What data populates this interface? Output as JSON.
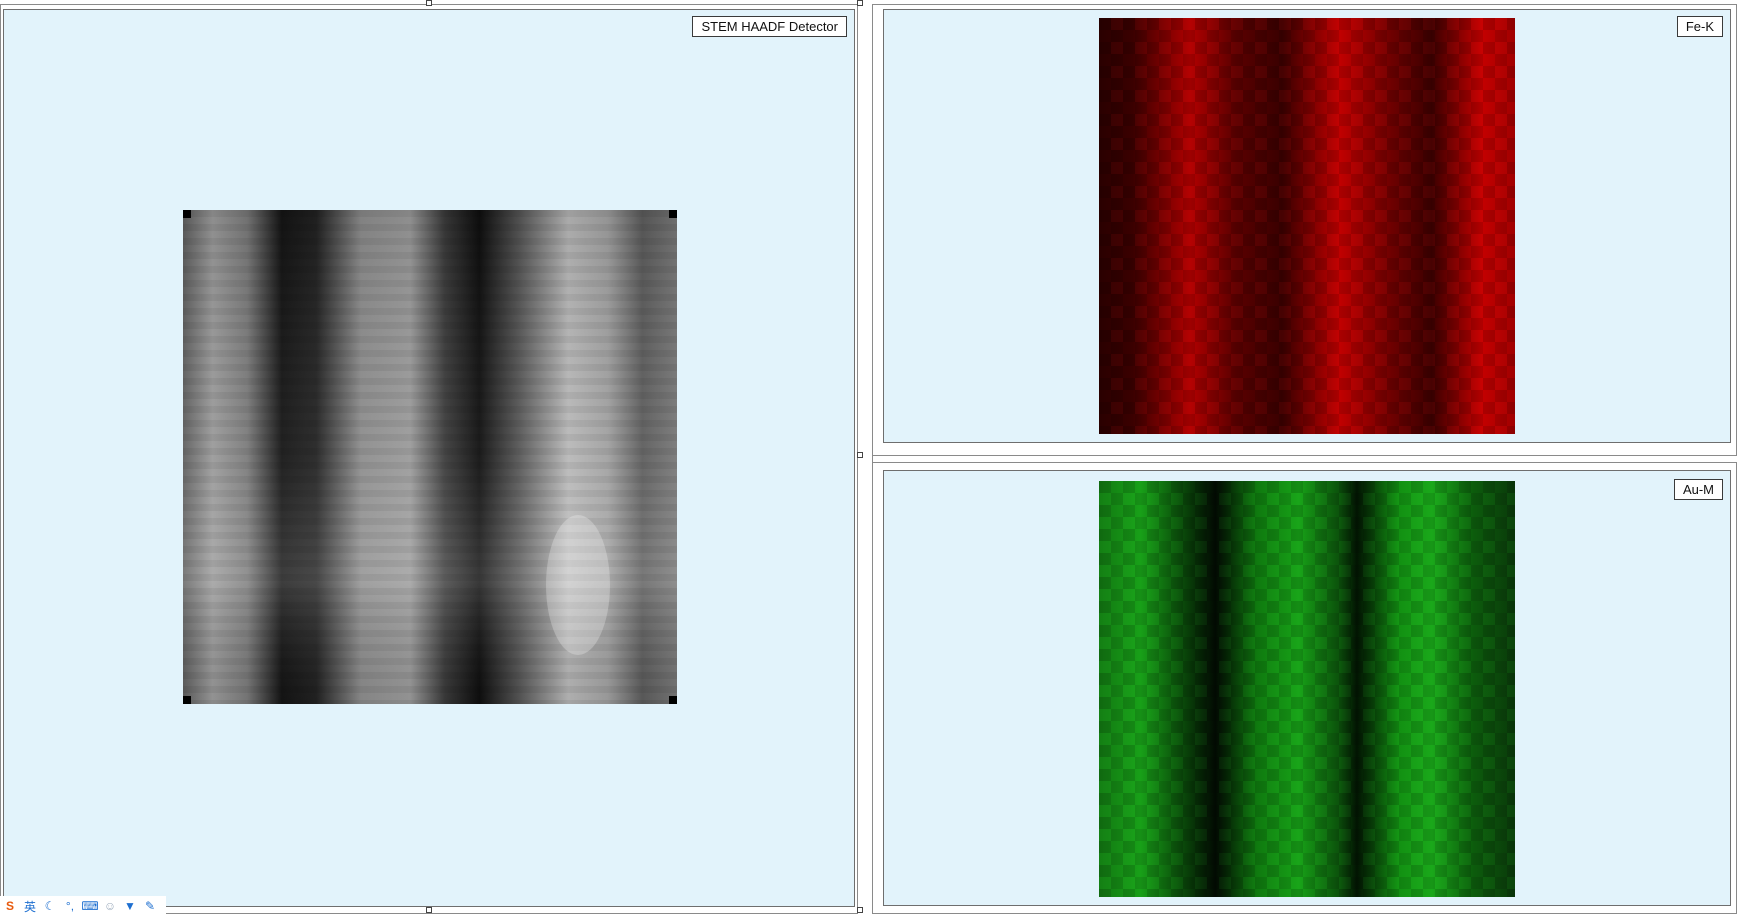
{
  "panels": {
    "haadf": {
      "label": "STEM HAADF Detector"
    },
    "fe": {
      "label": "Fe-K"
    },
    "au": {
      "label": "Au-M"
    }
  },
  "colors": {
    "background": "#e2f3fb",
    "fe_map": "#d80000",
    "au_map": "#1eaa1e"
  },
  "taskbar": {
    "input_method_label": "英",
    "icons": [
      "logo-icon",
      "ime-english-icon",
      "moon-icon",
      "punctuation-icon",
      "keyboard-icon",
      "user-icon",
      "shirt-icon",
      "wrench-icon"
    ]
  }
}
